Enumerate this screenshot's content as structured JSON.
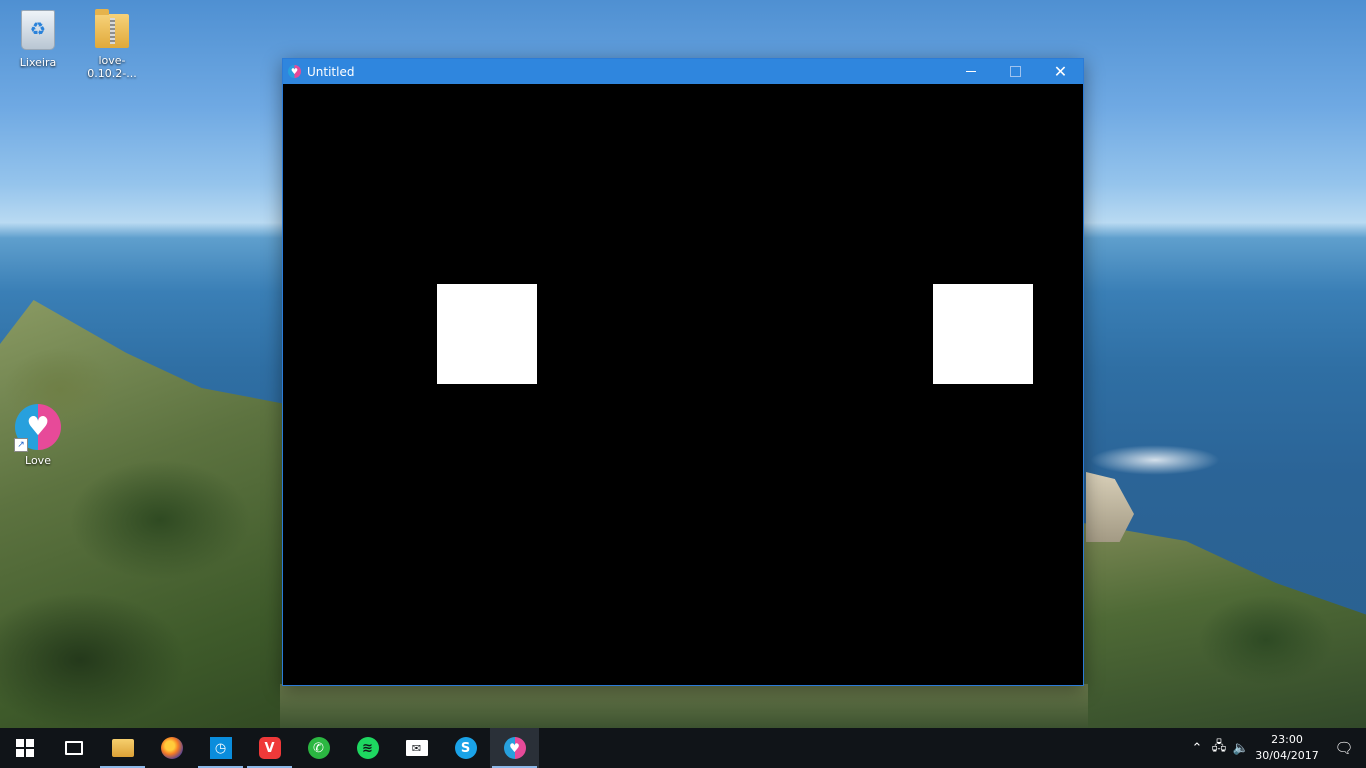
{
  "desktop": {
    "icons": [
      {
        "label": "Lixeira",
        "icon": "recycle-bin-icon"
      },
      {
        "label": "love-0.10.2-...",
        "icon": "folder-icon"
      },
      {
        "label": "Love",
        "icon": "love-app-icon"
      }
    ]
  },
  "window": {
    "title": "Untitled",
    "icon": "love-app-icon",
    "minimize_glyph": "",
    "maximize_glyph": "",
    "close_glyph": "✕"
  },
  "taskbar": {
    "apps": [
      {
        "name": "Start",
        "icon": "windows-start-icon"
      },
      {
        "name": "Task View",
        "icon": "task-view-icon"
      },
      {
        "name": "File Explorer",
        "icon": "file-explorer-icon"
      },
      {
        "name": "Firefox",
        "icon": "firefox-icon"
      },
      {
        "name": "Store",
        "icon": "store-icon"
      },
      {
        "name": "Vivaldi",
        "icon": "vivaldi-icon"
      },
      {
        "name": "WhatsApp",
        "icon": "whatsapp-icon"
      },
      {
        "name": "Spotify",
        "icon": "spotify-icon"
      },
      {
        "name": "Mail",
        "icon": "mail-icon"
      },
      {
        "name": "Skype",
        "icon": "skype-icon"
      },
      {
        "name": "LÖVE",
        "icon": "love-app-icon"
      }
    ],
    "tray": {
      "time": "23:00",
      "date": "30/04/2017"
    }
  },
  "colors": {
    "titlebar": "#2f86de",
    "canvas": "#000000",
    "box": "#ffffff",
    "taskbar": "#101418"
  }
}
